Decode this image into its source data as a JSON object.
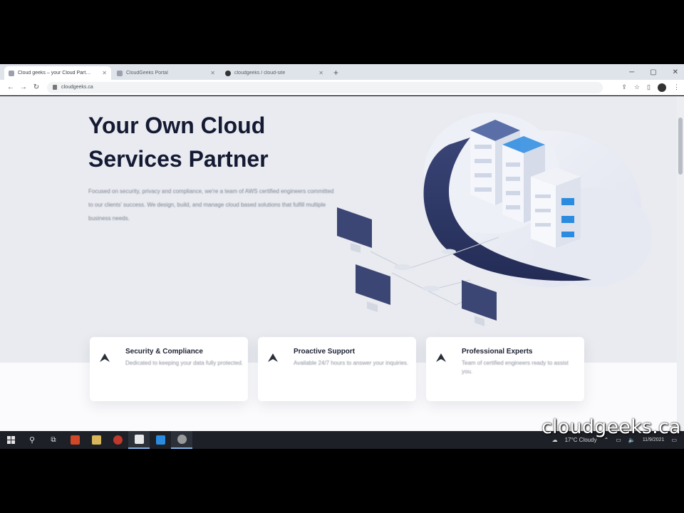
{
  "browser": {
    "tabs": [
      {
        "title": "Cloud geeks – your Cloud Part…",
        "active": true
      },
      {
        "title": "CloudGeeks Portal",
        "active": false
      },
      {
        "title": "cloudgeeks / cloud-site",
        "active": false
      }
    ],
    "new_tab_glyph": "+",
    "window_controls": [
      "─",
      "▢",
      "✕"
    ],
    "url": "cloudgeeks.ca",
    "nav": {
      "back": "←",
      "forward": "→",
      "reload": "↻"
    }
  },
  "hero": {
    "title": "Your Own Cloud\nServices Partner",
    "description": "Focused on security, privacy and compliance, we're a team of AWS certified engineers committed to our clients' success. We design, build, and manage cloud based solutions that fulfill multiple business needs."
  },
  "features": [
    {
      "icon": "shield-check-icon",
      "title": "Security & Compliance",
      "text": "Dedicated to keeping your data fully protected."
    },
    {
      "icon": "support-headset-icon",
      "title": "Proactive Support",
      "text": "Available 24/7 hours to answer your inquiries."
    },
    {
      "icon": "expert-badge-icon",
      "title": "Professional Experts",
      "text": "Team of certified engineers ready to assist you."
    }
  ],
  "taskbar": {
    "weather": "17°C  Cloudy",
    "time": "",
    "date": "11/9/2021"
  },
  "watermark": "cloudgeeks.ca",
  "colors": {
    "title": "#141a33",
    "server_blue": "#2a8be0",
    "cloud_dark": "#2b3566",
    "page_bg": "#e9ebf0",
    "taskbar": "#1d2027"
  }
}
